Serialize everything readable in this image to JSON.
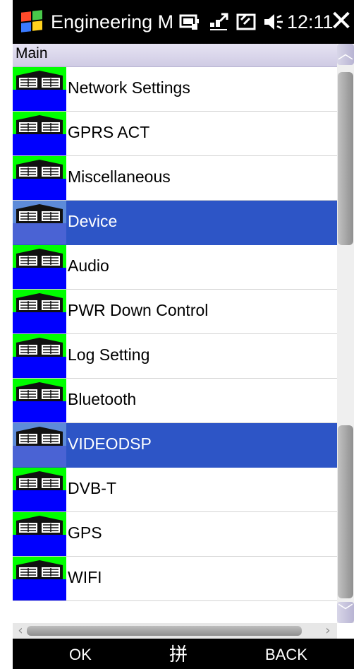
{
  "titlebar": {
    "title": "Engineering M",
    "time": "12:11",
    "icons": [
      "windows-flag-icon",
      "battery-icon",
      "connectivity-icon",
      "signal-icon",
      "volume-icon",
      "close-icon"
    ],
    "close_glyph": "✕"
  },
  "header": {
    "label": "Main"
  },
  "items": [
    {
      "label": "Network Settings",
      "selected": false
    },
    {
      "label": "GPRS ACT",
      "selected": false
    },
    {
      "label": "Miscellaneous",
      "selected": false
    },
    {
      "label": "Device",
      "selected": true
    },
    {
      "label": "Audio",
      "selected": false
    },
    {
      "label": "PWR Down Control",
      "selected": false
    },
    {
      "label": "Log Setting",
      "selected": false
    },
    {
      "label": "Bluetooth",
      "selected": false
    },
    {
      "label": "VIDEODSP",
      "selected": true
    },
    {
      "label": "DVB-T",
      "selected": false
    },
    {
      "label": "GPS",
      "selected": false
    },
    {
      "label": "WIFI",
      "selected": false
    }
  ],
  "softkeys": {
    "left": "OK",
    "middle": "拼",
    "right": "BACK"
  },
  "colors": {
    "selection": "#2d55c6",
    "icon_top": "#00ff00",
    "icon_bottom": "#0000ff",
    "bars": "#000000"
  }
}
